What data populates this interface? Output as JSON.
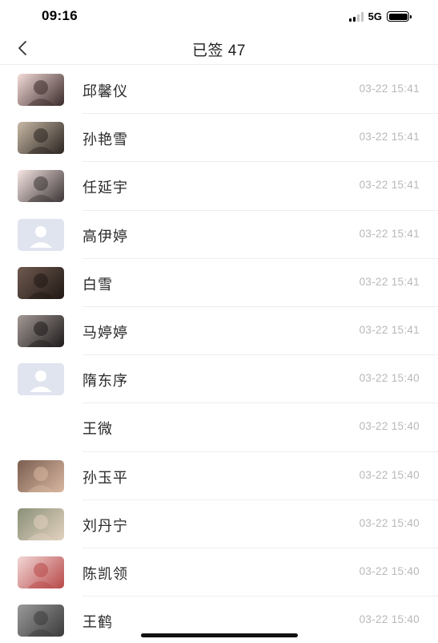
{
  "status_bar": {
    "time": "09:16",
    "network": "5G",
    "signal_bars_active": 2,
    "signal_bars_total": 4
  },
  "nav": {
    "title": "已签 47",
    "back_icon": "chevron-left-icon"
  },
  "rows": [
    {
      "name": "邱馨仪",
      "time": "03-22 15:41",
      "avatar": "photo",
      "avatar_colors": [
        "#f4dcd8",
        "#3a2a2a"
      ]
    },
    {
      "name": "孙艳雪",
      "time": "03-22 15:41",
      "avatar": "photo",
      "avatar_colors": [
        "#c9b9a6",
        "#2a2420"
      ]
    },
    {
      "name": "任延宇",
      "time": "03-22 15:41",
      "avatar": "photo",
      "avatar_colors": [
        "#f7e6e4",
        "#3b3535"
      ]
    },
    {
      "name": "高伊婷",
      "time": "03-22 15:41",
      "avatar": "placeholder",
      "avatar_colors": [
        "#dfe4ef",
        "#ffffff"
      ]
    },
    {
      "name": "白雪",
      "time": "03-22 15:41",
      "avatar": "photo",
      "avatar_colors": [
        "#6f5a50",
        "#201814"
      ]
    },
    {
      "name": "马婷婷",
      "time": "03-22 15:41",
      "avatar": "photo",
      "avatar_colors": [
        "#a49a96",
        "#1e1a1a"
      ]
    },
    {
      "name": "隋东序",
      "time": "03-22 15:40",
      "avatar": "placeholder",
      "avatar_colors": [
        "#dfe4ef",
        "#ffffff"
      ]
    },
    {
      "name": "王微",
      "time": "03-22 15:40",
      "avatar": "none",
      "avatar_colors": [
        "#ffffff",
        "#ffffff"
      ]
    },
    {
      "name": "孙玉平",
      "time": "03-22 15:40",
      "avatar": "photo",
      "avatar_colors": [
        "#7b5e52",
        "#d8b7a0"
      ]
    },
    {
      "name": "刘丹宁",
      "time": "03-22 15:40",
      "avatar": "photo",
      "avatar_colors": [
        "#8a9078",
        "#e3d2c0"
      ]
    },
    {
      "name": "陈凯领",
      "time": "03-22 15:40",
      "avatar": "photo",
      "avatar_colors": [
        "#f1d8d6",
        "#b84848"
      ]
    },
    {
      "name": "王鹤",
      "time": "03-22 15:40",
      "avatar": "photo",
      "avatar_colors": [
        "#9a9a9a",
        "#3a3a3a"
      ]
    }
  ]
}
